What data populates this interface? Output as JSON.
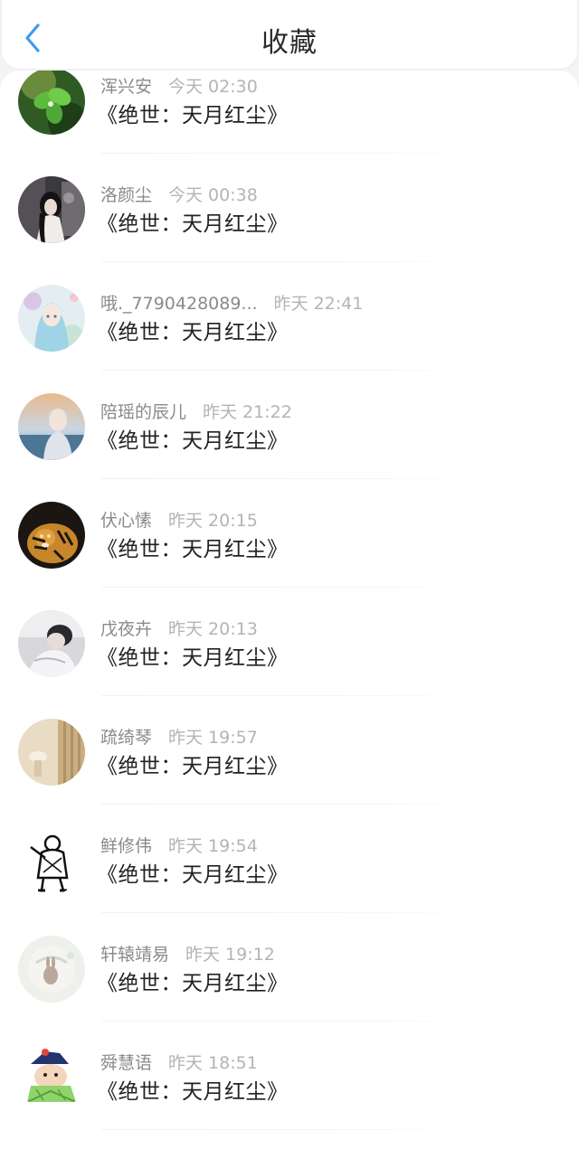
{
  "header": {
    "title": "收藏",
    "back_icon": "chevron-left-icon"
  },
  "colors": {
    "accent": "#3d9bf0",
    "title_text": "#2a2a2a",
    "username_text": "#8a8a8a",
    "time_text": "#b4b4b4",
    "book_text": "#222222"
  },
  "favorites": [
    {
      "user": "浑兴安",
      "time": "今天 02:30",
      "book": "《绝世：天月红尘》"
    },
    {
      "user": "洛颜尘",
      "time": "今天 00:38",
      "book": "《绝世：天月红尘》"
    },
    {
      "user": "哦._7790428089...",
      "time": "昨天 22:41",
      "book": "《绝世：天月红尘》"
    },
    {
      "user": "陪瑶的辰儿",
      "time": "昨天 21:22",
      "book": "《绝世：天月红尘》"
    },
    {
      "user": "伏心愫",
      "time": "昨天 20:15",
      "book": "《绝世：天月红尘》"
    },
    {
      "user": "戊夜卉",
      "time": "昨天 20:13",
      "book": "《绝世：天月红尘》"
    },
    {
      "user": "疏绮琴",
      "time": "昨天 19:57",
      "book": "《绝世：天月红尘》"
    },
    {
      "user": "鲜修伟",
      "time": "昨天 19:54",
      "book": "《绝世：天月红尘》"
    },
    {
      "user": "轩辕靖易",
      "time": "昨天 19:12",
      "book": "《绝世：天月红尘》"
    },
    {
      "user": "舜慧语",
      "time": "昨天 18:51",
      "book": "《绝世：天月红尘》"
    }
  ]
}
